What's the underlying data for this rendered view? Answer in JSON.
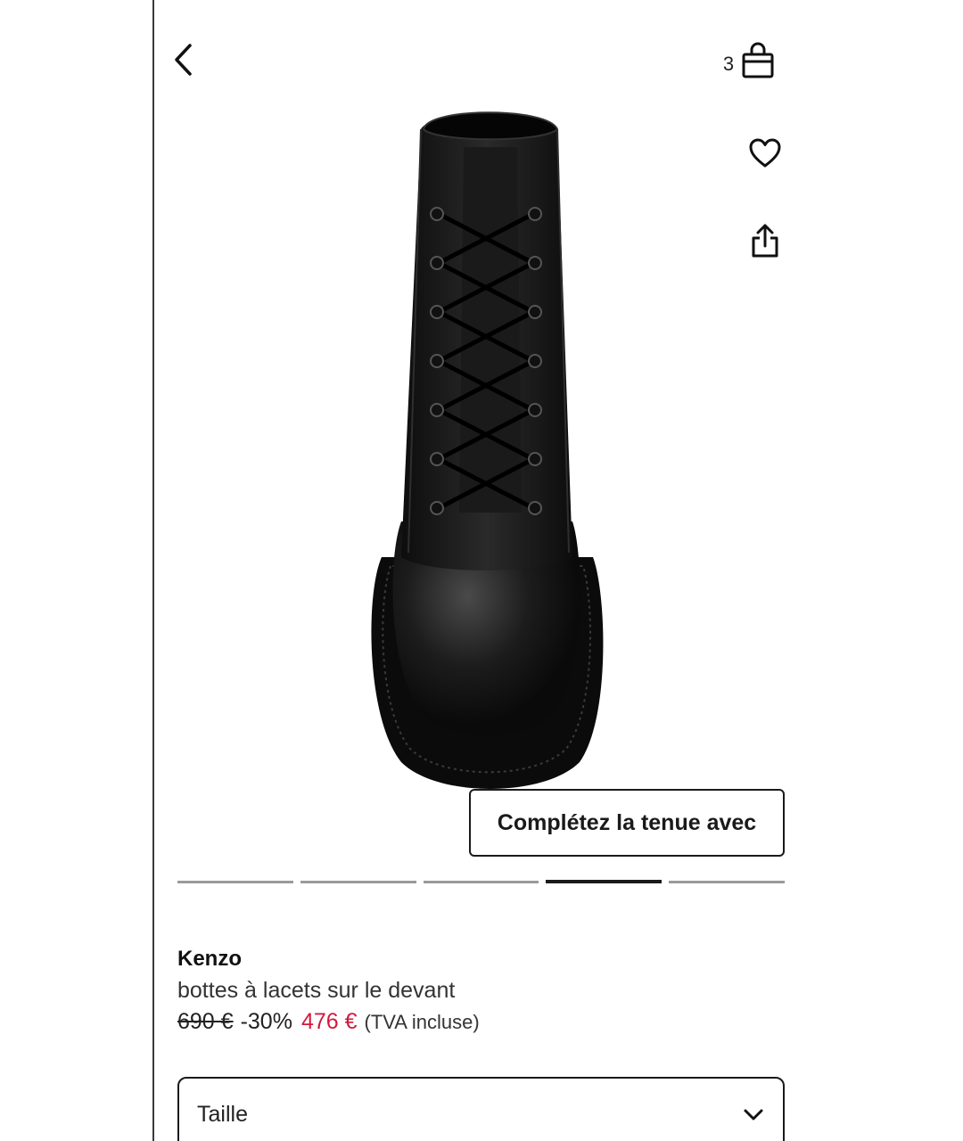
{
  "header": {
    "cart_count": "3",
    "icons": {
      "back": "chevron-left-icon",
      "cart": "shopping-bag-icon",
      "wishlist": "heart-icon",
      "share": "share-icon"
    }
  },
  "product": {
    "image": "black-lace-up-boot",
    "outfit_button_label": "Complétez la tenue avec",
    "carousel": {
      "count": 5,
      "active_index": 3
    },
    "brand": "Kenzo",
    "description": "bottes à lacets sur le devant",
    "price": {
      "original": "690 €",
      "discount": "-30%",
      "current": "476 €",
      "tax_note": "(TVA incluse)",
      "current_color": "#d11a3c"
    }
  },
  "size_selector": {
    "label": "Taille",
    "icon": "chevron-down-icon"
  }
}
